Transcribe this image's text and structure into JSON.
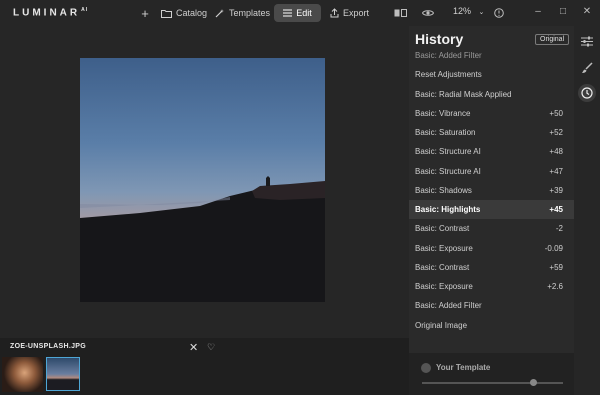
{
  "app": {
    "logo": "LUMINAR",
    "logo_suffix": "AI"
  },
  "topbar": {
    "catalog_label": "Catalog",
    "templates_label": "Templates",
    "edit_label": "Edit",
    "export_label": "Export",
    "zoom_value": "12%"
  },
  "filmstrip": {
    "filename": "ZOE-UNSPLASH.JPG"
  },
  "history": {
    "title": "History",
    "original_button": "Original",
    "items": [
      {
        "label": "Basic: Added Filter",
        "value": ""
      },
      {
        "label": "Reset Adjustments",
        "value": ""
      },
      {
        "label": "Basic: Radial Mask Applied",
        "value": ""
      },
      {
        "label": "Basic: Vibrance",
        "value": "+50"
      },
      {
        "label": "Basic: Saturation",
        "value": "+52"
      },
      {
        "label": "Basic: Structure AI",
        "value": "+48"
      },
      {
        "label": "Basic: Structure AI",
        "value": "+47"
      },
      {
        "label": "Basic: Shadows",
        "value": "+39"
      },
      {
        "label": "Basic: Highlights",
        "value": "+45"
      },
      {
        "label": "Basic: Contrast",
        "value": "-2"
      },
      {
        "label": "Basic: Exposure",
        "value": "-0.09"
      },
      {
        "label": "Basic: Contrast",
        "value": "+59"
      },
      {
        "label": "Basic: Exposure",
        "value": "+2.6"
      },
      {
        "label": "Basic: Added Filter",
        "value": ""
      },
      {
        "label": "Original Image",
        "value": ""
      }
    ]
  },
  "template": {
    "label": "Your Template"
  },
  "colors": {
    "accent": "#4ea6d6",
    "background": "#252525"
  }
}
